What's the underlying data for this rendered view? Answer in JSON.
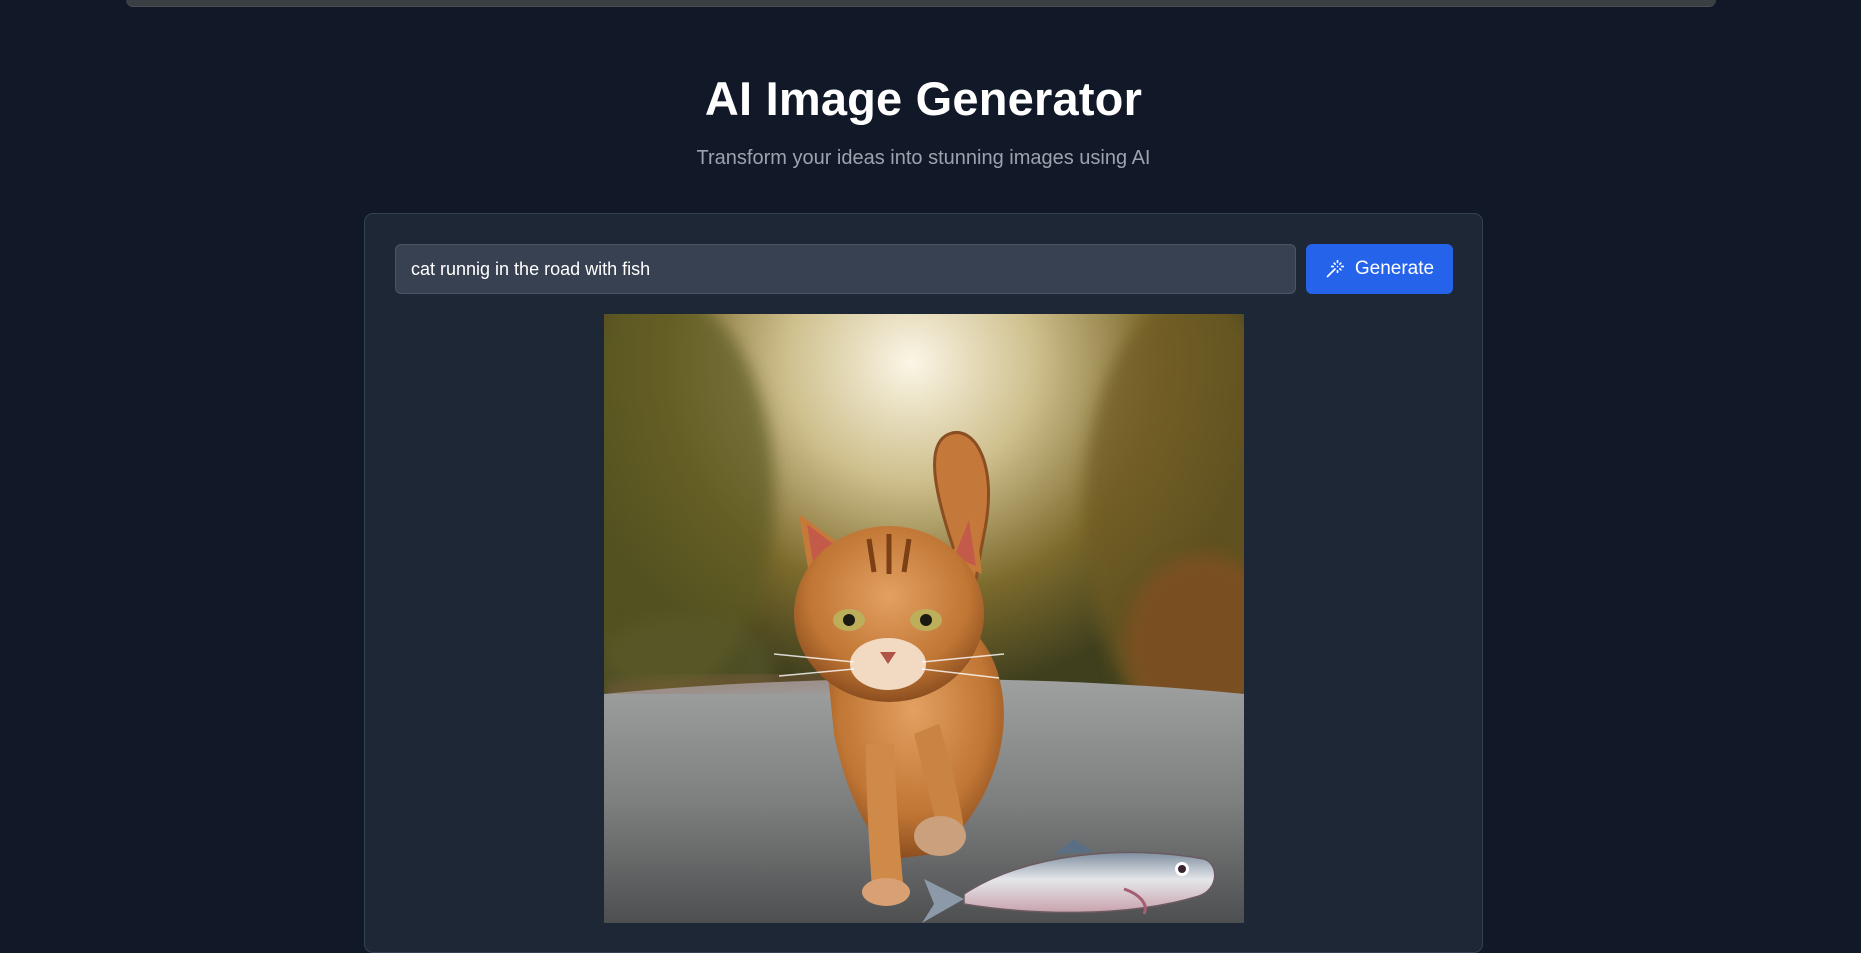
{
  "header": {
    "title": "AI Image Generator",
    "subtitle": "Transform your ideas into stunning images using AI"
  },
  "prompt": {
    "value": "cat runnig in the road with fish",
    "placeholder": ""
  },
  "generate_button": {
    "label": "Generate",
    "icon": "magic-wand-icon"
  },
  "colors": {
    "background": "#111827",
    "card": "#1e2736",
    "input": "#374151",
    "accent": "#2563eb"
  }
}
